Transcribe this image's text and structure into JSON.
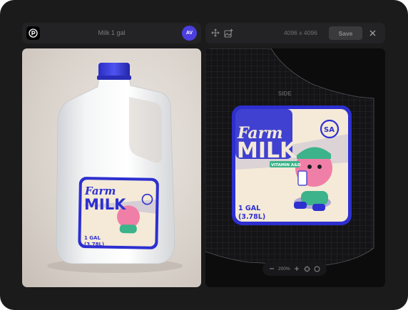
{
  "document": {
    "title": "Milk 1 gal",
    "user_initials": "AV"
  },
  "toolbar": {
    "dimensions": "4096 x 4096",
    "save_label": "Save"
  },
  "editor": {
    "side_label": "SIDE",
    "zoom_level": "200%"
  },
  "label_art": {
    "brand_line1": "Farm",
    "brand_line2": "MILK",
    "tagline": "VITAMIN A&D",
    "badge": "SA",
    "volume_line1": "1 GAL",
    "volume_line2": "(3.78L)"
  },
  "icons": {
    "logo": "app-logo-icon",
    "move": "move-icon",
    "image_add": "image-add-icon",
    "close": "close-icon",
    "zoom_out": "minus-icon",
    "zoom_in": "plus-icon",
    "fit": "frame-icon",
    "reset": "circle-icon"
  },
  "colors": {
    "accent": "#4b3fe0",
    "label_blue": "#2d2fd0",
    "label_cream": "#f4ead7",
    "character_pink": "#f07fa7",
    "character_green": "#3cb38a"
  }
}
